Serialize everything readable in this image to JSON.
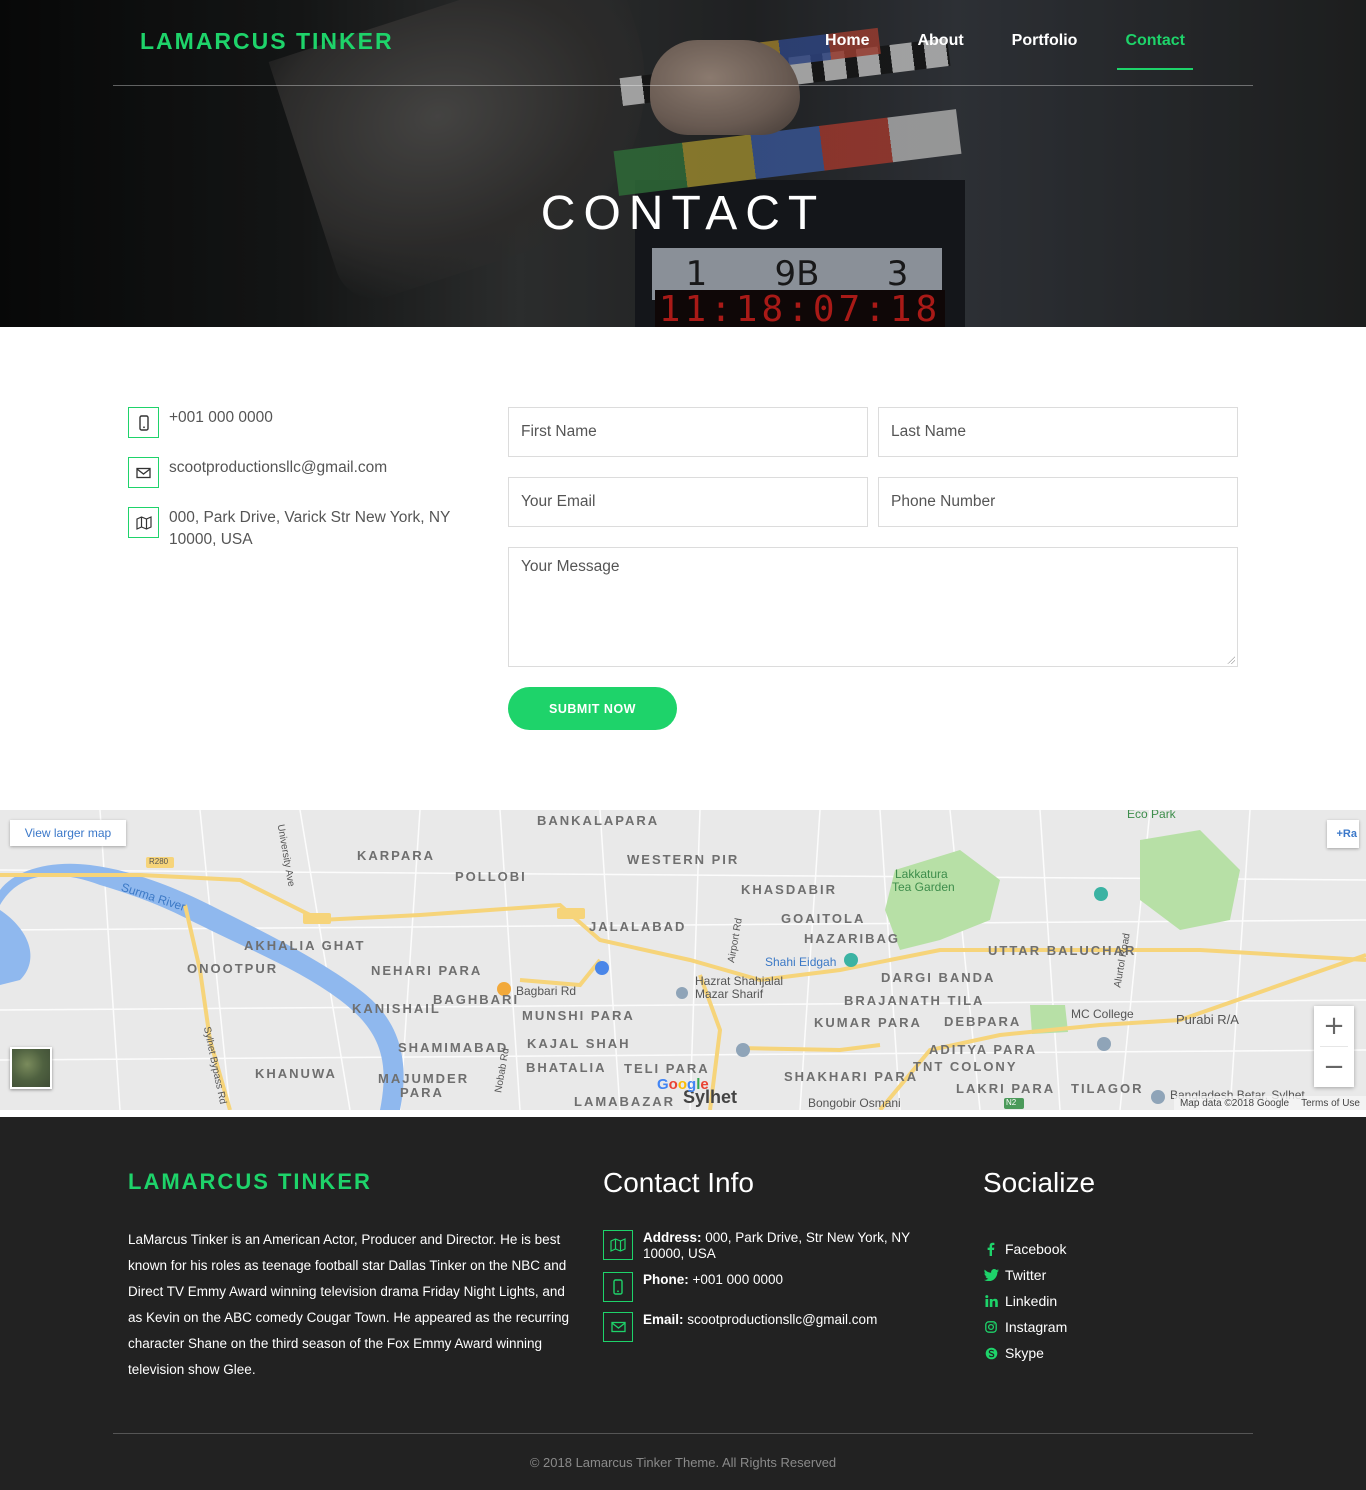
{
  "brand": {
    "name": "LAMARCUS TINKER",
    "accent_color": "#1ed36a"
  },
  "nav": {
    "items": [
      {
        "label": "Home"
      },
      {
        "label": "About"
      },
      {
        "label": "Portfolio"
      },
      {
        "label": "Contact",
        "active": true
      }
    ]
  },
  "hero": {
    "title": "CONTACT",
    "slate_numbers": [
      "1",
      "9B",
      "3"
    ],
    "slate_timer": "11:18:07:18"
  },
  "contact_info": {
    "phone": "+001 000 0000",
    "email": "scootproductionsllc@gmail.com",
    "address": "000, Park Drive, Varick Str New York, NY 10000, USA",
    "icons": [
      "mobile-icon",
      "envelope-icon",
      "map-icon"
    ]
  },
  "form": {
    "first_name_placeholder": "First Name",
    "last_name_placeholder": "Last Name",
    "email_placeholder": "Your Email",
    "phone_placeholder": "Phone Number",
    "message_placeholder": "Your Message",
    "submit_label": "SUBMIT NOW"
  },
  "map": {
    "view_larger_label": "View larger map",
    "corner_label": "+Ra",
    "zoom_in": "+",
    "zoom_out": "−",
    "attribution": "Map data ©2018 Google",
    "terms": "Terms of Use",
    "google_logo": "Google",
    "labels": [
      {
        "text": "BANKALAPARA",
        "cls": ""
      },
      {
        "text": "KARPARA",
        "cls": ""
      },
      {
        "text": "POLLOBI",
        "cls": ""
      },
      {
        "text": "WESTERN PIR",
        "cls": ""
      },
      {
        "text": "KHASDABIR",
        "cls": ""
      },
      {
        "text": "GOAITOLA",
        "cls": ""
      },
      {
        "text": "HAZARIBAG",
        "cls": ""
      },
      {
        "text": "JALALABAD",
        "cls": ""
      },
      {
        "text": "AKHALIA GHAT",
        "cls": ""
      },
      {
        "text": "ONOOTPUR",
        "cls": ""
      },
      {
        "text": "NEHARI PARA",
        "cls": ""
      },
      {
        "text": "KANISHAIL",
        "cls": ""
      },
      {
        "text": "BAGHBARI",
        "cls": ""
      },
      {
        "text": "MUNSHI PARA",
        "cls": ""
      },
      {
        "text": "SHAMIMABAD",
        "cls": ""
      },
      {
        "text": "KAJAL SHAH",
        "cls": ""
      },
      {
        "text": "BHATALIA",
        "cls": ""
      },
      {
        "text": "TELI PARA",
        "cls": ""
      },
      {
        "text": "KHANUWA",
        "cls": ""
      },
      {
        "text": "MAJUMDER",
        "cls": ""
      },
      {
        "text": "PARA",
        "cls": ""
      },
      {
        "text": "LAMABAZAR",
        "cls": ""
      },
      {
        "text": "Sylhet",
        "cls": "small"
      },
      {
        "text": "SHAKHARI PARA",
        "cls": ""
      },
      {
        "text": "TNT COLONY",
        "cls": ""
      },
      {
        "text": "LAKRI PARA",
        "cls": ""
      },
      {
        "text": "TILAGOR",
        "cls": ""
      },
      {
        "text": "ADITYA PARA",
        "cls": ""
      },
      {
        "text": "DEBPARA",
        "cls": ""
      },
      {
        "text": "KUMAR PARA",
        "cls": ""
      },
      {
        "text": "BRAJANATH TILA",
        "cls": ""
      },
      {
        "text": "DARGI BANDA",
        "cls": ""
      },
      {
        "text": "UTTAR BALUCHAR",
        "cls": ""
      },
      {
        "text": "Purabi R/A",
        "cls": "small"
      },
      {
        "text": "MC College",
        "cls": "small"
      },
      {
        "text": "Lakkatura",
        "cls": "green"
      },
      {
        "text": "Tea Garden",
        "cls": "green"
      },
      {
        "text": "Eco Park",
        "cls": "green"
      },
      {
        "text": "Shahi Eidgah",
        "cls": "blue"
      },
      {
        "text": "Hazrat Shahjalal",
        "cls": "small"
      },
      {
        "text": "Mazar Sharif",
        "cls": "small"
      },
      {
        "text": "Bagbari Rd",
        "cls": "small"
      },
      {
        "text": "Surma River",
        "cls": "blue"
      },
      {
        "text": "University Ave",
        "cls": "small"
      },
      {
        "text": "Sylhet Bypass Rd",
        "cls": "small"
      },
      {
        "text": "Airport Rd",
        "cls": "small"
      },
      {
        "text": "Nobab Rd",
        "cls": "small"
      },
      {
        "text": "Alurtol Road",
        "cls": "small"
      },
      {
        "text": "Bongobir Osmani",
        "cls": "small"
      },
      {
        "text": "Bangladesh Betar, Sylhet",
        "cls": "small"
      },
      {
        "text": "R280",
        "cls": "small"
      },
      {
        "text": "N2",
        "cls": "small"
      }
    ]
  },
  "footer": {
    "logo": "LAMARCUS TINKER",
    "about": "LaMarcus Tinker is an American Actor, Producer and Director. He is best known for his roles as teenage football star Dallas Tinker on the NBC and Direct TV Emmy Award winning television drama Friday Night Lights, and as Kevin on the ABC comedy Cougar Town. He appeared as the recurring character Shane on the third season of the Fox Emmy Award winning television show Glee.",
    "contact_heading": "Contact Info",
    "address_label": "Address:",
    "address": "000, Park Drive, Str New York, NY 10000, USA",
    "phone_label": "Phone:",
    "phone": "+001 000 0000",
    "email_label": "Email:",
    "email": "scootproductionsllc@gmail.com",
    "social_heading": "Socialize",
    "social": [
      {
        "label": "Facebook",
        "icon": "facebook-icon"
      },
      {
        "label": "Twitter",
        "icon": "twitter-icon"
      },
      {
        "label": "Linkedin",
        "icon": "linkedin-icon"
      },
      {
        "label": "Instagram",
        "icon": "instagram-icon"
      },
      {
        "label": "Skype",
        "icon": "skype-icon"
      }
    ],
    "copyright": "© 2018 Lamarcus Tinker Theme. All Rights Reserved"
  }
}
